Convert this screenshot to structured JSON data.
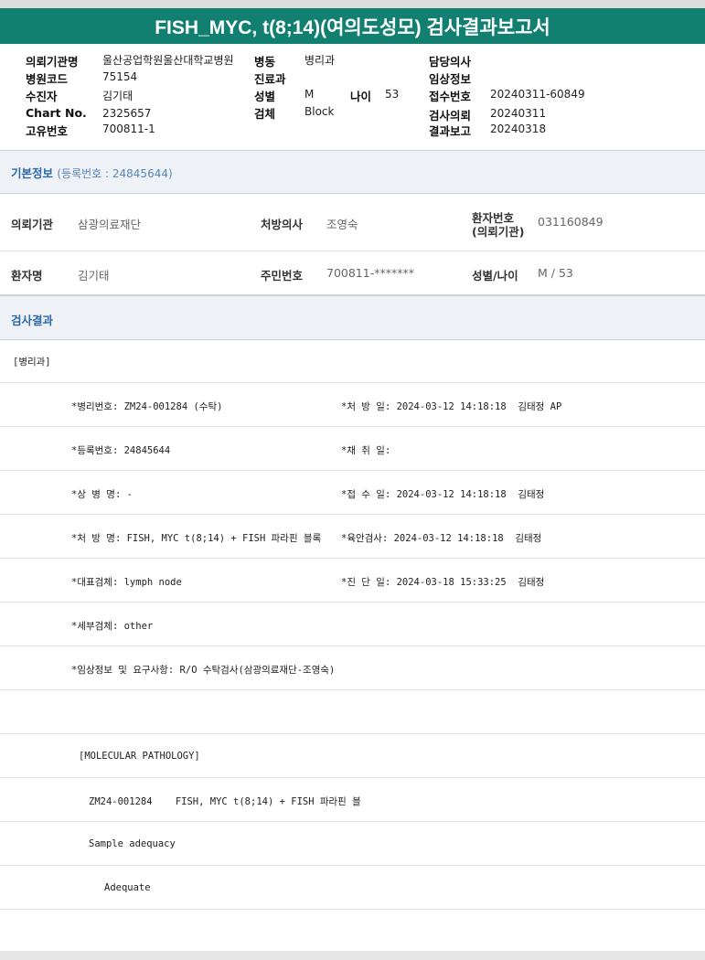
{
  "title": "FISH_MYC, t(8;14)(여의도성모) 검사결과보고서",
  "header": {
    "col1": [
      {
        "label": "의뢰기관명",
        "value": "울산공업학원울산대학교병원"
      },
      {
        "label": "병원코드",
        "value": "75154"
      },
      {
        "label": "수진자",
        "value": "김기태"
      },
      {
        "label": "Chart No.",
        "value": "2325657"
      },
      {
        "label": "고유번호",
        "value": "700811-1"
      }
    ],
    "col2": [
      {
        "label": "병동",
        "value": "병리과"
      },
      {
        "label": "진료과",
        "value": ""
      },
      {
        "label": "성별",
        "value": "M"
      },
      {
        "label": "검체",
        "value": "Block"
      }
    ],
    "age": {
      "label": "나이",
      "value": "53"
    },
    "col3": [
      {
        "label": "담당의사",
        "value": ""
      },
      {
        "label": "임상정보",
        "value": ""
      },
      {
        "label": "접수번호",
        "value": "20240311-60849"
      },
      {
        "label": "검사의뢰",
        "value": "20240311"
      },
      {
        "label": "결과보고",
        "value": "20240318"
      }
    ]
  },
  "basic": {
    "title": "기본정보",
    "subtitle": "(등록번호 : 24845644)",
    "row1": [
      {
        "label": "의뢰기관",
        "value": "삼광의료재단"
      },
      {
        "label": "처방의사",
        "value": "조영숙"
      },
      {
        "label": "환자번호 (의뢰기관)",
        "label_line1": "환자번호",
        "label_line2": "(의뢰기관)",
        "value": "031160849"
      }
    ],
    "row2": [
      {
        "label": "환자명",
        "value": "김기태"
      },
      {
        "label": "주민번호",
        "value": "700811-*******"
      },
      {
        "label": "성별/나이",
        "value": "M / 53"
      }
    ]
  },
  "results": {
    "title": "검사결과",
    "dept": "[병리과]",
    "rows": [
      {
        "left": "*병리번호: ZM24-001284 (수탁)",
        "right": "*처 방 일: 2024-03-12 14:18:18  김태정 AP"
      },
      {
        "left": "*등록번호: 24845644",
        "right": "*채 취 일:"
      },
      {
        "left": "*상 병 명: -",
        "right": "*접 수 일: 2024-03-12 14:18:18  김태정"
      },
      {
        "left": "*처 방 명: FISH, MYC t(8;14) + FISH 파라핀 블록",
        "right": "*육안검사: 2024-03-12 14:18:18  김태정"
      },
      {
        "left": "*대표검체: lymph node",
        "right": "*진 단 일: 2024-03-18 15:33:25  김태정"
      },
      {
        "left": "*세부검체: other",
        "right": ""
      },
      {
        "left": "*임상정보 및 요구사항: R/O 수탁검사(삼광의료재단-조영숙)",
        "right": ""
      }
    ],
    "molecular_header": "[MOLECULAR PATHOLOGY]",
    "molecular_line": "ZM24-001284    FISH, MYC t(8;14) + FISH 파라핀 블",
    "adequacy_label": "Sample adequacy",
    "adequacy_value": "Adequate"
  }
}
